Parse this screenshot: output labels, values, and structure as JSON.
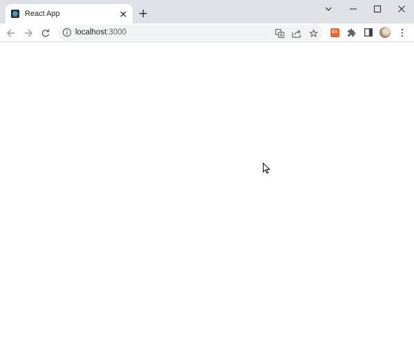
{
  "browser": {
    "tab": {
      "title": "React App",
      "favicon": "react-logo-icon"
    },
    "address_bar": {
      "host": "localhost",
      "port": ":3000"
    },
    "icons": {
      "back": "arrow-left-icon",
      "forward": "arrow-right-icon",
      "reload": "reload-icon",
      "site_info": "info-icon",
      "translate": "translate-icon",
      "share": "share-icon",
      "bookmark": "star-icon",
      "extensions": "puzzle-icon",
      "side_panel": "side-panel-icon",
      "menu": "kebab-menu-icon"
    },
    "colors": {
      "titlebar": "#dee1e6",
      "omnibox": "#f1f3f4",
      "extension_accent": "#e8672b"
    }
  },
  "page": {
    "background": "#ffffff",
    "content": ""
  }
}
